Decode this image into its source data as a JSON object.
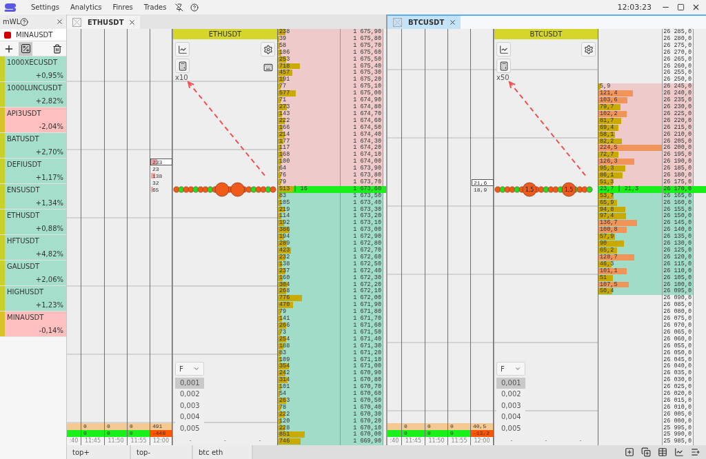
{
  "menu": {
    "items": [
      "Settings",
      "Analytics",
      "Finres",
      "Trades"
    ],
    "clock": "12:03:23"
  },
  "sidebar": {
    "title": "mWL",
    "active_symbol": "MINAUSDT",
    "percent_mode": true,
    "items": [
      {
        "name": "1000XECUSDT",
        "change": "+0,95%",
        "kind": "up"
      },
      {
        "name": "1000LUNCUSDT",
        "change": "+2,82%",
        "kind": "up"
      },
      {
        "name": "API3USDT",
        "change": "-2,04%",
        "kind": "down"
      },
      {
        "name": "BATUSDT",
        "change": "+2,70%",
        "kind": "up"
      },
      {
        "name": "DEFIUSDT",
        "change": "+1,17%",
        "kind": "up"
      },
      {
        "name": "ENSUSDT",
        "change": "+1,34%",
        "kind": "up"
      },
      {
        "name": "ETHUSDT",
        "change": "+0,88%",
        "kind": "up"
      },
      {
        "name": "HFTUSDT",
        "change": "+4,82%",
        "kind": "up"
      },
      {
        "name": "GALUSDT",
        "change": "+2,06%",
        "kind": "up"
      },
      {
        "name": "HIGHUSDT",
        "change": "+1,23%",
        "kind": "up"
      },
      {
        "name": "MINAUSDT",
        "change": "-0,14%",
        "kind": "down"
      }
    ]
  },
  "windows": [
    {
      "tab": {
        "label": "ETHUSDT",
        "selected": false
      },
      "chart": {
        "title": "ETHUSDT",
        "multiplier": "x10",
        "keyboard_button": true,
        "bubbles": [
          {
            "kind": "big"
          },
          {
            "kind": "big"
          }
        ],
        "filter": {
          "value": "F",
          "options": [
            {
              "label": "0,001",
              "selected": true
            },
            {
              "label": "0,002",
              "selected": false
            },
            {
              "label": "0,003",
              "selected": false
            },
            {
              "label": "0,004",
              "selected": false
            },
            {
              "label": "0,005",
              "selected": false
            }
          ]
        },
        "axis_labels": [
          "-",
          "-",
          "-"
        ]
      },
      "time_columns": [
        {
          "time": ":40"
        },
        {
          "time": "11:45",
          "buy": "0",
          "sell": "0",
          "sell_negative": false
        },
        {
          "time": "11:50",
          "buy": "0",
          "sell": "0",
          "sell_negative": false
        },
        {
          "time": "11:55",
          "buy": "0",
          "sell": "0",
          "sell_negative": false
        },
        {
          "time": "12:00",
          "buy": "491",
          "sell": "-448",
          "sell_negative": true
        }
      ],
      "side_numbers": [
        {
          "text": "233",
          "highlighted": true,
          "level": 0.3
        },
        {
          "text": "23",
          "highlighted": false,
          "level": 0
        },
        {
          "text": "138",
          "highlighted": false,
          "level": 0.2
        },
        {
          "text": "32",
          "highlighted": false,
          "level": 0
        },
        {
          "text": "65",
          "highlighted": false,
          "level": 0.1
        }
      ],
      "book": [
        {
          "kind": "ask",
          "volume": "238",
          "price": "1 675,90",
          "level": 0.12
        },
        {
          "kind": "ask",
          "volume": "39",
          "price": "1 675,80",
          "level": 0.02
        },
        {
          "kind": "ask",
          "volume": "58",
          "price": "1 675,70",
          "level": 0.03
        },
        {
          "kind": "ask",
          "volume": "106",
          "price": "1 675,60",
          "level": 0.05
        },
        {
          "kind": "ask",
          "volume": "253",
          "price": "1 675,50",
          "level": 0.13
        },
        {
          "kind": "ask",
          "volume": "718",
          "price": "1 675,40",
          "level": 0.36
        },
        {
          "kind": "ask",
          "volume": "457",
          "price": "1 675,30",
          "level": 0.23
        },
        {
          "kind": "ask",
          "volume": "191",
          "price": "1 675,20",
          "level": 0.1
        },
        {
          "kind": "ask",
          "volume": "77",
          "price": "1 675,10",
          "level": 0.04
        },
        {
          "kind": "ask",
          "volume": "577",
          "price": "1 675,00",
          "level": 0.29
        },
        {
          "kind": "ask",
          "volume": "71",
          "price": "1 674,90",
          "level": 0.04
        },
        {
          "kind": "ask",
          "volume": "273",
          "price": "1 674,80",
          "level": 0.14
        },
        {
          "kind": "ask",
          "volume": "143",
          "price": "1 674,70",
          "level": 0.07
        },
        {
          "kind": "ask",
          "volume": "222",
          "price": "1 674,60",
          "level": 0.11
        },
        {
          "kind": "ask",
          "volume": "166",
          "price": "1 674,50",
          "level": 0.08
        },
        {
          "kind": "ask",
          "volume": "214",
          "price": "1 674,40",
          "level": 0.11
        },
        {
          "kind": "ask",
          "volume": "177",
          "price": "1 674,30",
          "level": 0.09
        },
        {
          "kind": "ask",
          "volume": "117",
          "price": "1 674,20",
          "level": 0.06
        },
        {
          "kind": "ask",
          "volume": "168",
          "price": "1 674,10",
          "level": 0.08
        },
        {
          "kind": "ask",
          "volume": "100",
          "price": "1 674,00",
          "level": 0.05
        },
        {
          "kind": "ask",
          "volume": "64",
          "price": "1 673,90",
          "level": 0.03
        },
        {
          "kind": "ask",
          "volume": "76",
          "price": "1 673,80",
          "level": 0.04
        },
        {
          "kind": "ask",
          "volume": "79",
          "price": "1 673,70",
          "level": 0.04
        },
        {
          "kind": "mid",
          "volume": "513 | 16",
          "price": "1 673,60",
          "level": 0.26
        },
        {
          "kind": "bid",
          "volume": "83",
          "price": "1 673,50",
          "level": 0.04
        },
        {
          "kind": "bid",
          "volume": "105",
          "price": "1 673,40",
          "level": 0.05
        },
        {
          "kind": "bid",
          "volume": "219",
          "price": "1 673,30",
          "level": 0.11
        },
        {
          "kind": "bid",
          "volume": "114",
          "price": "1 673,20",
          "level": 0.06
        },
        {
          "kind": "bid",
          "volume": "192",
          "price": "1 673,10",
          "level": 0.1
        },
        {
          "kind": "bid",
          "volume": "386",
          "price": "1 673,00",
          "level": 0.19
        },
        {
          "kind": "bid",
          "volume": "194",
          "price": "1 672,90",
          "level": 0.1
        },
        {
          "kind": "bid",
          "volume": "289",
          "price": "1 672,80",
          "level": 0.14
        },
        {
          "kind": "bid",
          "volume": "423",
          "price": "1 672,70",
          "level": 0.21
        },
        {
          "kind": "bid",
          "volume": "232",
          "price": "1 672,60",
          "level": 0.12
        },
        {
          "kind": "bid",
          "volume": "138",
          "price": "1 672,50",
          "level": 0.07
        },
        {
          "kind": "bid",
          "volume": "237",
          "price": "1 672,40",
          "level": 0.12
        },
        {
          "kind": "bid",
          "volume": "160",
          "price": "1 672,30",
          "level": 0.08
        },
        {
          "kind": "bid",
          "volume": "304",
          "price": "1 672,20",
          "level": 0.15
        },
        {
          "kind": "bid",
          "volume": "268",
          "price": "1 672,10",
          "level": 0.13
        },
        {
          "kind": "bid",
          "volume": "776",
          "price": "1 672,00",
          "level": 0.39
        },
        {
          "kind": "bid",
          "volume": "470",
          "price": "1 671,90",
          "level": 0.24
        },
        {
          "kind": "bid",
          "volume": "79",
          "price": "1 671,80",
          "level": 0.04
        },
        {
          "kind": "bid",
          "volume": "141",
          "price": "1 671,70",
          "level": 0.07
        },
        {
          "kind": "bid",
          "volume": "266",
          "price": "1 671,60",
          "level": 0.13
        },
        {
          "kind": "bid",
          "volume": "73",
          "price": "1 671,50",
          "level": 0.04
        },
        {
          "kind": "bid",
          "volume": "254",
          "price": "1 671,40",
          "level": 0.13
        },
        {
          "kind": "bid",
          "volume": "188",
          "price": "1 671,30",
          "level": 0.09
        },
        {
          "kind": "bid",
          "volume": "83",
          "price": "1 671,20",
          "level": 0.04
        },
        {
          "kind": "bid",
          "volume": "109",
          "price": "1 671,10",
          "level": 0.05
        },
        {
          "kind": "bid",
          "volume": "354",
          "price": "1 671,00",
          "level": 0.18
        },
        {
          "kind": "bid",
          "volume": "242",
          "price": "1 670,90",
          "level": 0.12
        },
        {
          "kind": "bid",
          "volume": "314",
          "price": "1 670,80",
          "level": 0.16
        },
        {
          "kind": "bid",
          "volume": "101",
          "price": "1 670,70",
          "level": 0.05
        },
        {
          "kind": "bid",
          "volume": "54",
          "price": "1 670,60",
          "level": 0.03
        },
        {
          "kind": "bid",
          "volume": "263",
          "price": "1 670,50",
          "level": 0.13
        },
        {
          "kind": "bid",
          "volume": "78",
          "price": "1 670,40",
          "level": 0.04
        },
        {
          "kind": "bid",
          "volume": "222",
          "price": "1 670,30",
          "level": 0.11
        },
        {
          "kind": "bid",
          "volume": "120",
          "price": "1 670,20",
          "level": 0.06
        },
        {
          "kind": "bid",
          "volume": "228",
          "price": "1 670,10",
          "level": 0.11
        },
        {
          "kind": "bid",
          "volume": "851",
          "price": "1 670,00",
          "level": 0.43
        },
        {
          "kind": "bid",
          "volume": "746",
          "price": "1 669,90",
          "level": 0.37
        }
      ]
    },
    {
      "tab": {
        "label": "BTCUSDT",
        "selected": true
      },
      "chart": {
        "title": "BTCUSDT",
        "multiplier": "x50",
        "bubbles": [
          {
            "kind": "big",
            "label": "1,5"
          },
          {
            "kind": "big",
            "label": "1,5"
          }
        ],
        "filter": {
          "value": "F",
          "options": [
            {
              "label": "0,001",
              "selected": true
            },
            {
              "label": "0,002",
              "selected": false
            },
            {
              "label": "0,003",
              "selected": false
            },
            {
              "label": "0,004",
              "selected": false
            },
            {
              "label": "0,005",
              "selected": false
            }
          ]
        },
        "axis_labels": [
          "-",
          "-",
          "-"
        ]
      },
      "time_columns": [
        {
          "time": ":40"
        },
        {
          "time": "11:45",
          "buy": "0",
          "sell": "0",
          "sell_negative": false
        },
        {
          "time": "11:50",
          "buy": "0",
          "sell": "0",
          "sell_negative": false
        },
        {
          "time": "11:55",
          "buy": "0",
          "sell": "0",
          "sell_negative": false
        },
        {
          "time": "12:00",
          "buy": "40,5",
          "sell": "-13,2",
          "sell_negative": true
        }
      ],
      "side_numbers": [
        {
          "text": "21,6",
          "highlighted": true,
          "level": 0
        },
        {
          "text": "18,9",
          "highlighted": false,
          "level": 0
        }
      ],
      "book": [
        {
          "kind": "empty",
          "price": "26 285,0"
        },
        {
          "kind": "empty",
          "price": "26 280,0"
        },
        {
          "kind": "empty",
          "price": "26 275,0"
        },
        {
          "kind": "empty",
          "price": "26 270,0"
        },
        {
          "kind": "empty",
          "price": "26 265,0"
        },
        {
          "kind": "empty",
          "price": "26 260,0"
        },
        {
          "kind": "empty",
          "price": "26 255,0"
        },
        {
          "kind": "empty",
          "price": "26 250,0"
        },
        {
          "kind": "ask",
          "volume": "5,9",
          "price": "26 245,0",
          "level": 0.03,
          "color": "#c8aa00"
        },
        {
          "kind": "ask",
          "volume": "121,4",
          "price": "26 240,0",
          "level": 0.54,
          "color": "#f0945a"
        },
        {
          "kind": "ask",
          "volume": "103,6",
          "price": "26 235,0",
          "level": 0.46,
          "color": "#f0945a"
        },
        {
          "kind": "ask",
          "volume": "79,7",
          "price": "26 230,0",
          "level": 0.35,
          "color": "#c8aa00"
        },
        {
          "kind": "ask",
          "volume": "102,2",
          "price": "26 225,0",
          "level": 0.45,
          "color": "#f0945a"
        },
        {
          "kind": "ask",
          "volume": "81,7",
          "price": "26 220,0",
          "level": 0.36,
          "color": "#c8aa00"
        },
        {
          "kind": "ask",
          "volume": "69,4",
          "price": "26 215,0",
          "level": 0.31,
          "color": "#c8aa00"
        },
        {
          "kind": "ask",
          "volume": "58,1",
          "price": "26 210,0",
          "level": 0.26,
          "color": "#c8aa00"
        },
        {
          "kind": "ask",
          "volume": "82,2",
          "price": "26 205,0",
          "level": 0.37,
          "color": "#c8aa00"
        },
        {
          "kind": "ask",
          "volume": "224,5",
          "price": "26 200,0",
          "level": 1,
          "color": "#f0945a"
        },
        {
          "kind": "ask",
          "volume": "72,7",
          "price": "26 195,0",
          "level": 0.32,
          "color": "#c8aa00"
        },
        {
          "kind": "ask",
          "volume": "126,3",
          "price": "26 190,0",
          "level": 0.56,
          "color": "#f0945a"
        },
        {
          "kind": "ask",
          "volume": "95,3",
          "price": "26 185,0",
          "level": 0.42,
          "color": "#c8aa00"
        },
        {
          "kind": "ask",
          "volume": "86,1",
          "price": "26 180,0",
          "level": 0.38,
          "color": "#c8aa00"
        },
        {
          "kind": "ask",
          "volume": "51,3",
          "price": "26 175,0",
          "level": 0.23,
          "color": "#c8aa00"
        },
        {
          "kind": "mid",
          "volume": "23,7 | 21,3",
          "price": "26 170,0"
        },
        {
          "kind": "bid",
          "volume": "53,7",
          "price": "26 165,0",
          "level": 0.24,
          "color": "#c8aa00"
        },
        {
          "kind": "bid",
          "volume": "65,9",
          "price": "26 160,0",
          "level": 0.29,
          "color": "#c8aa00"
        },
        {
          "kind": "bid",
          "volume": "94,8",
          "price": "26 155,0",
          "level": 0.42,
          "color": "#c8aa00"
        },
        {
          "kind": "bid",
          "volume": "97,4",
          "price": "26 150,0",
          "level": 0.43,
          "color": "#c8aa00"
        },
        {
          "kind": "bid",
          "volume": "136,7",
          "price": "26 145,0",
          "level": 0.61,
          "color": "#f0945a"
        },
        {
          "kind": "bid",
          "volume": "100,8",
          "price": "26 140,0",
          "level": 0.45,
          "color": "#f0945a"
        },
        {
          "kind": "bid",
          "volume": "57,9",
          "price": "26 135,0",
          "level": 0.26,
          "color": "#c8aa00"
        },
        {
          "kind": "bid",
          "volume": "90",
          "price": "26 130,0",
          "level": 0.4,
          "color": "#c8aa00"
        },
        {
          "kind": "bid",
          "volume": "65,2",
          "price": "26 125,0",
          "level": 0.29,
          "color": "#c8aa00"
        },
        {
          "kind": "bid",
          "volume": "128,7",
          "price": "26 120,0",
          "level": 0.57,
          "color": "#f0945a"
        },
        {
          "kind": "bid",
          "volume": "46,3",
          "price": "26 115,0",
          "level": 0.21,
          "color": "#c8aa00"
        },
        {
          "kind": "bid",
          "volume": "101,1",
          "price": "26 110,0",
          "level": 0.45,
          "color": "#f0945a"
        },
        {
          "kind": "bid",
          "volume": "51",
          "price": "26 105,0",
          "level": 0.23,
          "color": "#c8aa00"
        },
        {
          "kind": "bid",
          "volume": "107,5",
          "price": "26 100,0",
          "level": 0.48,
          "color": "#f0945a"
        },
        {
          "kind": "bid",
          "volume": "50,4",
          "price": "26 095,0",
          "level": 0.22,
          "color": "#c8aa00"
        },
        {
          "kind": "empty",
          "price": "26 090,0"
        },
        {
          "kind": "empty",
          "price": "26 085,0"
        },
        {
          "kind": "empty",
          "price": "26 080,0"
        },
        {
          "kind": "empty",
          "price": "26 075,0"
        },
        {
          "kind": "empty",
          "price": "26 070,0"
        },
        {
          "kind": "empty",
          "price": "26 065,0"
        },
        {
          "kind": "empty",
          "price": "26 060,0"
        },
        {
          "kind": "empty",
          "price": "26 055,0"
        },
        {
          "kind": "empty",
          "price": "26 050,0"
        },
        {
          "kind": "empty",
          "price": "26 045,0"
        },
        {
          "kind": "empty",
          "price": "26 040,0"
        },
        {
          "kind": "empty",
          "price": "26 035,0"
        },
        {
          "kind": "empty",
          "price": "26 030,0"
        },
        {
          "kind": "empty",
          "price": "26 025,0"
        },
        {
          "kind": "empty",
          "price": "26 020,0"
        },
        {
          "kind": "empty",
          "price": "26 015,0"
        },
        {
          "kind": "empty",
          "price": "26 010,0"
        },
        {
          "kind": "empty",
          "price": "26 005,0"
        },
        {
          "kind": "empty",
          "price": "26 000,0"
        },
        {
          "kind": "empty",
          "price": "25 995,0"
        },
        {
          "kind": "empty",
          "price": "25 990,0"
        },
        {
          "kind": "empty",
          "price": "25 985,0"
        }
      ]
    }
  ],
  "bottom_tabs": [
    "top+",
    "top-",
    "btc eth"
  ]
}
